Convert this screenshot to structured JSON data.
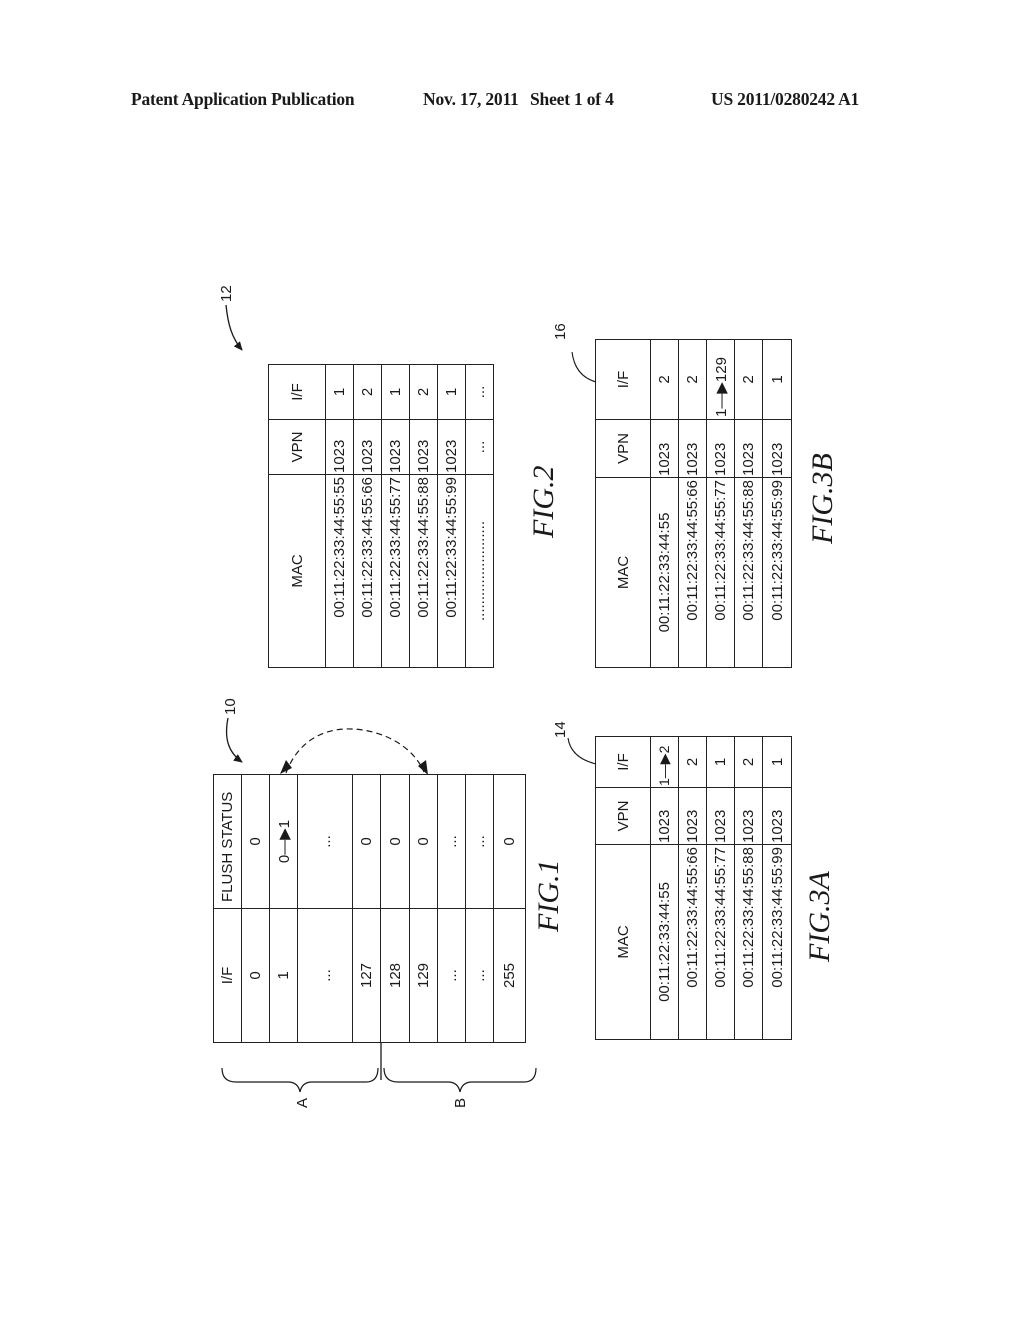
{
  "header": {
    "publication": "Patent Application Publication",
    "date": "Nov. 17, 2011",
    "sheet": "Sheet 1 of 4",
    "number": "US 2011/0280242 A1"
  },
  "fig1": {
    "label": "FIG.1",
    "ref": "10",
    "columns": [
      "I/F",
      "FLUSH STATUS"
    ],
    "rows": [
      {
        "if": "0",
        "flush": "0"
      },
      {
        "if": "1",
        "flush_from": "0",
        "flush_to": "1"
      },
      {
        "if": "...",
        "flush": "..."
      },
      {
        "if": "127",
        "flush": "0"
      },
      {
        "if": "128",
        "flush": "0"
      },
      {
        "if": "129",
        "flush": "0"
      },
      {
        "if": "...",
        "flush": "..."
      },
      {
        "if": "...",
        "flush": "..."
      },
      {
        "if": "255",
        "flush": "0"
      }
    ],
    "groups": [
      "A",
      "B"
    ]
  },
  "fig2": {
    "label": "FIG.2",
    "ref": "12",
    "columns": [
      "MAC",
      "VPN",
      "I/F"
    ],
    "rows": [
      {
        "mac": "00:11:22:33:44:55:55",
        "vpn": "1023",
        "if": "1"
      },
      {
        "mac": "00:11:22:33:44:55:66",
        "vpn": "1023",
        "if": "2"
      },
      {
        "mac": "00:11:22:33:44:55:77",
        "vpn": "1023",
        "if": "1"
      },
      {
        "mac": "00:11:22:33:44:55:88",
        "vpn": "1023",
        "if": "2"
      },
      {
        "mac": "00:11:22:33:44:55:99",
        "vpn": "1023",
        "if": "1"
      },
      {
        "mac": "........................",
        "vpn": "...",
        "if": "..."
      }
    ]
  },
  "fig3a": {
    "label": "FIG.3A",
    "ref": "14",
    "columns": [
      "MAC",
      "VPN",
      "I/F"
    ],
    "rows": [
      {
        "mac": "00:11:22:33:44:55",
        "vpn": "1023",
        "if_from": "1",
        "if_to": "2"
      },
      {
        "mac": "00:11:22:33:44:55:66",
        "vpn": "1023",
        "if": "2"
      },
      {
        "mac": "00:11:22:33:44:55:77",
        "vpn": "1023",
        "if": "1"
      },
      {
        "mac": "00:11:22:33:44:55:88",
        "vpn": "1023",
        "if": "2"
      },
      {
        "mac": "00:11:22:33:44:55:99",
        "vpn": "1023",
        "if": "1"
      }
    ]
  },
  "fig3b": {
    "label": "FIG.3B",
    "ref": "16",
    "columns": [
      "MAC",
      "VPN",
      "I/F"
    ],
    "rows": [
      {
        "mac": "00:11:22:33:44:55",
        "vpn": "1023",
        "if": "2"
      },
      {
        "mac": "00:11:22:33:44:55:66",
        "vpn": "1023",
        "if": "2"
      },
      {
        "mac": "00:11:22:33:44:55:77",
        "vpn": "1023",
        "if_from": "1",
        "if_to": "129"
      },
      {
        "mac": "00:11:22:33:44:55:88",
        "vpn": "1023",
        "if": "2"
      },
      {
        "mac": "00:11:22:33:44:55:99",
        "vpn": "1023",
        "if": "1"
      }
    ]
  }
}
